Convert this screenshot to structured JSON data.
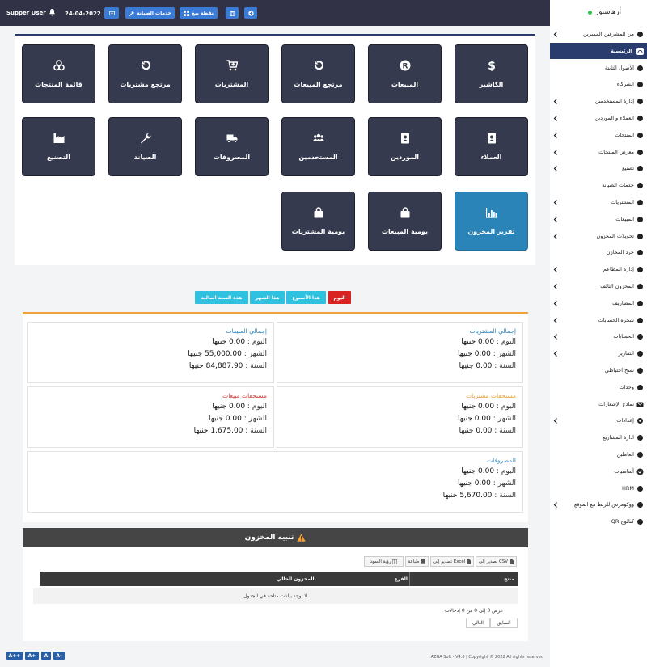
{
  "topbar": {
    "user": "Supper User",
    "date": "24-04-2022",
    "maintenance_btn": "خدمات الصيانة",
    "pos_btn": "نقطة بيع"
  },
  "tiles": [
    {
      "label": "الكاشير",
      "icon": "dollar-icon"
    },
    {
      "label": "المبيعات",
      "icon": "registered-icon"
    },
    {
      "label": "مرتجع المبيعات",
      "icon": "undo-icon"
    },
    {
      "label": "المشتريات",
      "icon": "cart-plus-icon"
    },
    {
      "label": "مرتجع مشتريات",
      "icon": "undo-icon"
    },
    {
      "label": "قائمة المنتجات",
      "icon": "cubes-icon"
    },
    {
      "label": "العملاء",
      "icon": "contact-book-icon"
    },
    {
      "label": "الموردين",
      "icon": "contact-book-icon"
    },
    {
      "label": "المستخدمين",
      "icon": "users-icon"
    },
    {
      "label": "المصروفات",
      "icon": "truck-icon"
    },
    {
      "label": "الصيانة",
      "icon": "wrench-icon"
    },
    {
      "label": "التصنيع",
      "icon": "industry-icon"
    },
    {
      "label": "تقرير المخزون",
      "icon": "bar-chart-icon"
    },
    {
      "label": "يومية المبيعات",
      "icon": "shopping-bag-icon"
    },
    {
      "label": "يومية المشتريات",
      "icon": "shopping-bag-icon"
    }
  ],
  "periods": [
    "اليوم",
    "هذا الأسبوع",
    "هذا الشهر",
    "هذه السنة المالية"
  ],
  "stats": {
    "purchases": {
      "title": "إجمالي المشتريات",
      "rows": [
        {
          "k": "اليوم :",
          "v": "0.00 جنيها"
        },
        {
          "k": "الشهر :",
          "v": "0.00 جنيها"
        },
        {
          "k": "السنة :",
          "v": "0.00 جنيها"
        }
      ]
    },
    "sales": {
      "title": "إجمالي المبيعات",
      "rows": [
        {
          "k": "اليوم :",
          "v": "0.00 جنيها"
        },
        {
          "k": "الشهر :",
          "v": "55,000.00 جنيها"
        },
        {
          "k": "السنة :",
          "v": "84,887.90 جنيها"
        }
      ]
    },
    "purchases_due": {
      "title": "مستحقات مشتريات",
      "rows": [
        {
          "k": "اليوم :",
          "v": "0.00 جنيها"
        },
        {
          "k": "الشهر :",
          "v": "0.00 جنيها"
        },
        {
          "k": "السنة :",
          "v": "0.00 جنيها"
        }
      ]
    },
    "sales_due": {
      "title": "مستحقات مبيعات",
      "rows": [
        {
          "k": "اليوم :",
          "v": "0.00 جنيها"
        },
        {
          "k": "الشهر :",
          "v": "0.00 جنيها"
        },
        {
          "k": "السنة :",
          "v": "1,675.00 جنيها"
        }
      ]
    },
    "expenses": {
      "title": "المصروفات",
      "rows": [
        {
          "k": "اليوم :",
          "v": "0.00 جنيها"
        },
        {
          "k": "الشهر :",
          "v": "0.00 جنيها"
        },
        {
          "k": "السنة :",
          "v": "5,670.00 جنيها"
        }
      ]
    }
  },
  "alert": {
    "title": "تنبيه المخزون",
    "export_csv": "تصدير إلى CSV",
    "export_excel": "تصدير إلى Excel",
    "print": "طباعة",
    "columns_view": "رؤية العمود",
    "col_product": "منتج",
    "col_branch": "الفرع",
    "col_stock": "المخزون الحالي",
    "empty": "لا توجد بيانات متاحة في الجدول",
    "info": "عرض 0 إلى 0 من 0 إدخالات",
    "prev": "السابق",
    "next": "التالي"
  },
  "footer": {
    "text": "AZHA Soft - V4.0 | Copyright © 2022 All rights reserved",
    "font_btns": [
      "A++",
      "A+",
      "A",
      "A-"
    ]
  },
  "sidebar": {
    "brand": "أزهاستور",
    "items": [
      {
        "label": "من المشرفين المميزين",
        "icon": "users-cog-icon",
        "chev": true
      },
      {
        "label": "الرئيسية",
        "icon": "dashboard-icon",
        "chev": false,
        "active": true
      },
      {
        "label": "الأصول الثابتة",
        "icon": "user-icon",
        "chev": false
      },
      {
        "label": "الشركاء",
        "icon": "user-icon",
        "chev": false
      },
      {
        "label": "إدارة المستخدمين",
        "icon": "users-icon",
        "chev": true
      },
      {
        "label": "العملاء و الموردين",
        "icon": "address-book-icon",
        "chev": true
      },
      {
        "label": "المنتجات",
        "icon": "cubes-icon",
        "chev": true
      },
      {
        "label": "معرض المنتجات",
        "icon": "truck-icon",
        "chev": true
      },
      {
        "label": "تصنيع",
        "icon": "industry-icon",
        "chev": true
      },
      {
        "label": "خدمات الصيانة",
        "icon": "wrench-icon",
        "chev": false
      },
      {
        "label": "المشتريات",
        "icon": "arrow-circle-down-icon",
        "chev": true
      },
      {
        "label": "المبيعات",
        "icon": "arrow-circle-up-icon",
        "chev": true
      },
      {
        "label": "تحويلات المخزون",
        "icon": "truck-icon",
        "chev": true
      },
      {
        "label": "جرد المخازن",
        "icon": "boxes-icon",
        "chev": false
      },
      {
        "label": "إدارة المطاعم",
        "icon": "utensils-icon",
        "chev": true
      },
      {
        "label": "المخزون التالف",
        "icon": "database-icon",
        "chev": true
      },
      {
        "label": "المصاريف",
        "icon": "minus-circle-icon",
        "chev": true
      },
      {
        "label": "شجرة الحسابات",
        "icon": "sitemap-icon",
        "chev": true
      },
      {
        "label": "الحسابات",
        "icon": "money-icon",
        "chev": true
      },
      {
        "label": "التقارير",
        "icon": "bar-chart-icon",
        "chev": true
      },
      {
        "label": "نسخ احتياطي",
        "icon": "hdd-icon",
        "chev": false
      },
      {
        "label": "وحدات",
        "icon": "plug-icon",
        "chev": false
      },
      {
        "label": "نماذج الإشعارات",
        "icon": "envelope-icon",
        "chev": false
      },
      {
        "label": "إعدادات",
        "icon": "gear-icon",
        "chev": true
      },
      {
        "label": "ادارة المشاريع",
        "icon": "project-diagram-icon",
        "chev": false
      },
      {
        "label": "العاملين",
        "icon": "network-icon",
        "chev": false
      },
      {
        "label": "أساسيات",
        "icon": "check-circle-icon",
        "chev": false
      },
      {
        "label": "HRM",
        "icon": "users-icon",
        "chev": false
      },
      {
        "label": "ووكومرس للربط مع الموقع",
        "icon": "wordpress-icon",
        "chev": true
      },
      {
        "label": "كتالوج QR",
        "icon": "globe-icon",
        "chev": false
      }
    ]
  }
}
